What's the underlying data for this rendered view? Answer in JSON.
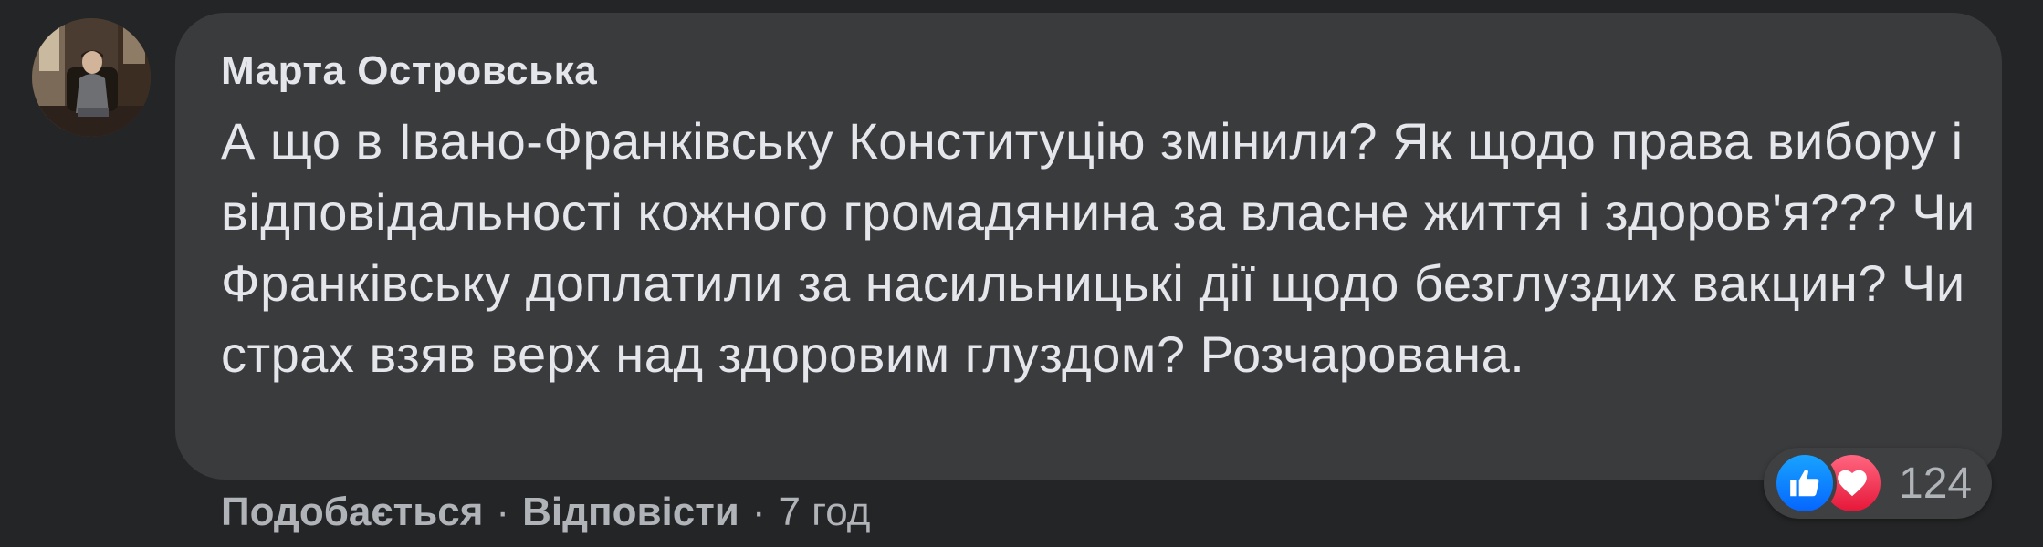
{
  "comment": {
    "author": "Марта Островська",
    "text": "А що в Івано-Франківську Конституцію змінили? Як щодо права вибору і відповідальності кожного громадянина за власне життя і здоров'я??? Чи Франківську доплатили за насильницькі дії щодо безглуздих вакцин? Чи страх взяв верх над здоровим глуздом? Розчарована.",
    "avatar_icon": "user-photo"
  },
  "actions": {
    "like_label": "Подобається",
    "separator": "·",
    "reply_label": "Відповісти",
    "time": "7 год"
  },
  "reactions": {
    "icons": [
      "like-icon",
      "love-icon"
    ],
    "count": "124",
    "like_color": "#1877f2",
    "love_color": "#f33e58"
  },
  "colors": {
    "background": "#242526",
    "bubble": "#3a3b3c",
    "text": "#e4e6eb",
    "secondary_text": "#b0b3b8"
  }
}
